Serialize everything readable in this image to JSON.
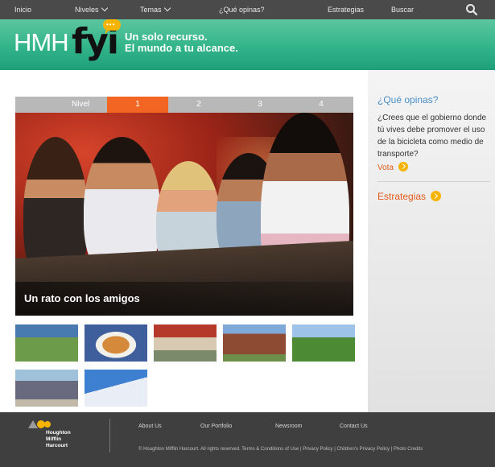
{
  "topnav": {
    "items": [
      {
        "label": "Inicio",
        "dropdown": false
      },
      {
        "label": "Niveles",
        "dropdown": true
      },
      {
        "label": "Temas",
        "dropdown": true
      },
      {
        "label": "¿Qué opinas?",
        "dropdown": false
      },
      {
        "label": "Estrategias",
        "dropdown": false
      },
      {
        "label": "Buscar",
        "dropdown": false
      }
    ],
    "search_icon": "search-icon"
  },
  "banner": {
    "logo_hmh": "HMH",
    "logo_fyi": "fyi",
    "tagline_line1": "Un solo recurso.",
    "tagline_line2": "El mundo a tu alcance.",
    "colors": {
      "banner_green": "#32b489",
      "accent_yellow": "#f6b400"
    }
  },
  "levels": {
    "label": "Nivel",
    "tabs": [
      "1",
      "2",
      "3",
      "4"
    ],
    "active": "1",
    "active_color": "#f26522"
  },
  "hero": {
    "caption": "Un rato con los amigos"
  },
  "thumbnails": [
    {
      "name": "thumb-group-outdoors"
    },
    {
      "name": "thumb-food-plate"
    },
    {
      "name": "thumb-cafe-terrace"
    },
    {
      "name": "thumb-brick-house"
    },
    {
      "name": "thumb-soccer-field"
    },
    {
      "name": "thumb-friends-standing"
    },
    {
      "name": "thumb-snowboarder"
    }
  ],
  "sidebar": {
    "question_title": "¿Qué opinas?",
    "question_text": "¿Crees que el gobierno donde tú vives debe promover el uso de la bicicleta como medio de transporte?",
    "vote_label": "Vota",
    "strategies_label": "Estrategias",
    "title_color": "#4a8fc7",
    "link_color": "#e25b1b"
  },
  "footer": {
    "logo_lines": [
      "Houghton",
      "Mifflin",
      "Harcourt"
    ],
    "links": [
      "About Us",
      "Our Portfolio",
      "Newsroom",
      "Contact Us"
    ],
    "copyright": "© Houghton Mifflin Harcourt. All rights reserved.",
    "legal_links": [
      "Terms & Conditions of Use",
      "Privacy Policy",
      "Children's Privacy Policy",
      "Photo Credits"
    ]
  }
}
